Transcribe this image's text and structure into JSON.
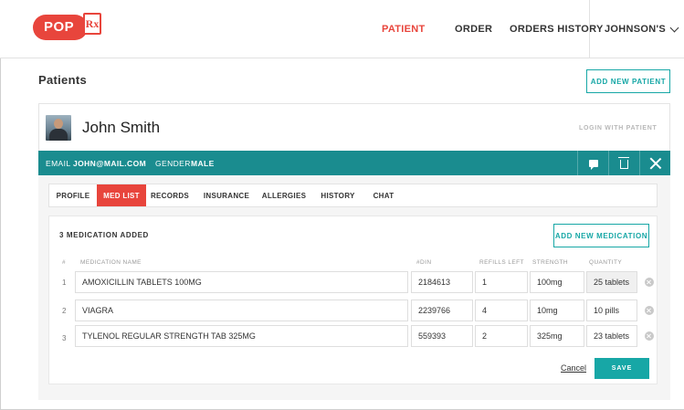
{
  "header": {
    "logo_text": "POP",
    "logo_rx": "Rx",
    "nav": {
      "patient": "PATIENT",
      "order": "ORDER",
      "orders_history": "ORDERS HISTORY",
      "user": "JOHNSON'S"
    },
    "active_nav": "PATIENT"
  },
  "page": {
    "title": "Patients",
    "add_patient_label": "ADD NEW PATIENT"
  },
  "patient": {
    "name": "John Smith",
    "login_label": "LOGIN WITH PATIENT",
    "email_label": "EMAIL",
    "email_value": "JOHN@MAIL.COM",
    "gender_label": "GENDER",
    "gender_value": "MALE"
  },
  "tabs": [
    {
      "label": "PROFILE"
    },
    {
      "label": "MED LIST",
      "active": true
    },
    {
      "label": "RECORDS"
    },
    {
      "label": "INSURANCE"
    },
    {
      "label": "ALLERGIES"
    },
    {
      "label": "HISTORY"
    },
    {
      "label": "CHAT"
    }
  ],
  "medlist": {
    "count_label": "3 MEDICATION ADDED",
    "add_medication_label": "ADD NEW MEDICATION",
    "columns": {
      "num": "#",
      "name": "MEDICATION NAME",
      "din": "#DIN",
      "refills": "REFILLS LEFT",
      "strength": "STRENGTH",
      "quantity": "QUANTITY"
    },
    "rows": [
      {
        "num": "1",
        "name": "AMOXICILLIN TABLETS 100MG",
        "din": "2184613",
        "refills": "1",
        "strength": "100mg",
        "quantity": "25 tablets"
      },
      {
        "num": "2",
        "name": "VIAGRA",
        "din": "2239766",
        "refills": "4",
        "strength": "10mg",
        "quantity": "10 pills"
      },
      {
        "num": "3",
        "name": "TYLENOL REGULAR STRENGTH TAB 325MG",
        "din": "559393",
        "refills": "2",
        "strength": "325mg",
        "quantity": "23 tablets"
      }
    ],
    "cancel_label": "Cancel",
    "save_label": "SAVE"
  },
  "colors": {
    "brand_red": "#e8453c",
    "teal": "#17a7a6",
    "teal_dark": "#1a8c8f"
  }
}
